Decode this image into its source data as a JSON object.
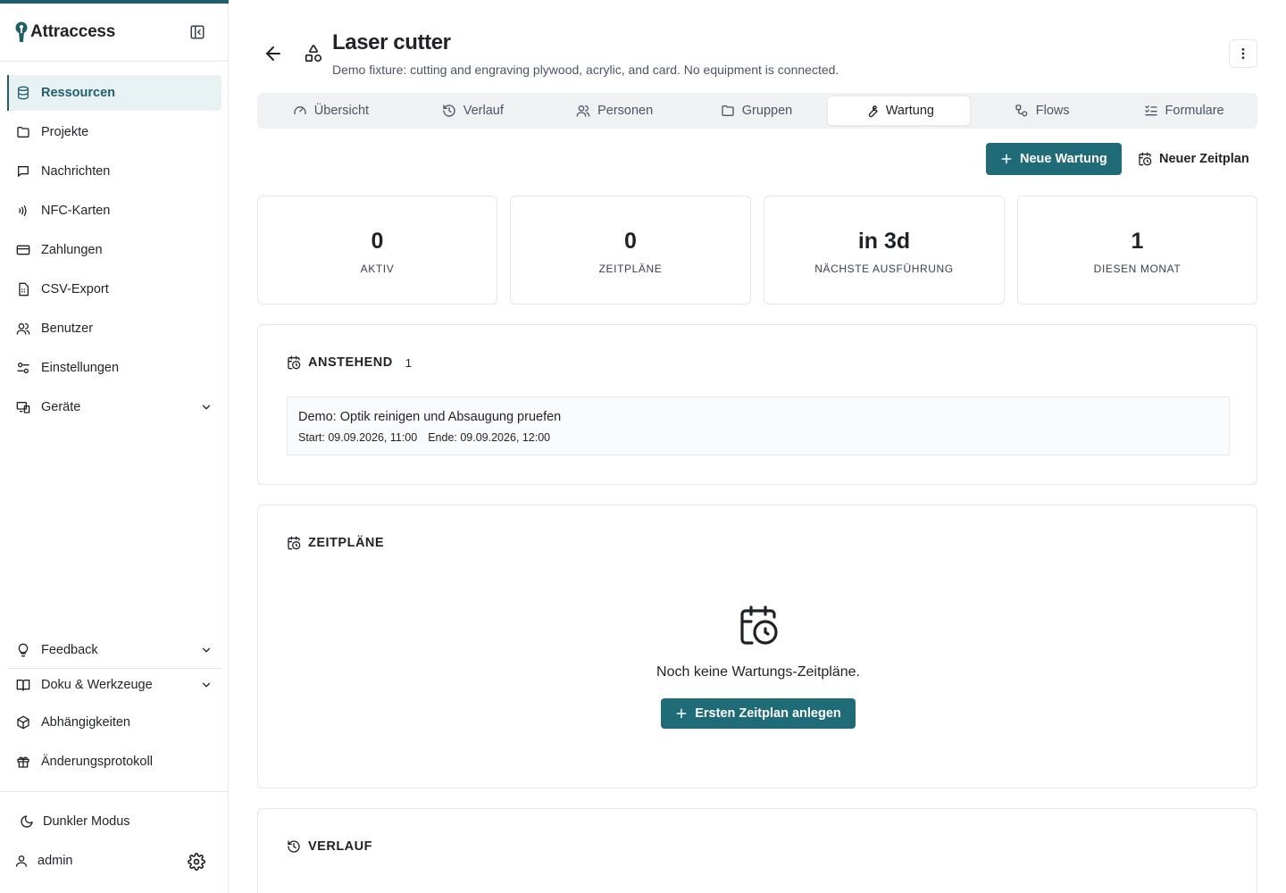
{
  "app": {
    "name": "Attraccess",
    "accent": "#1f6c78",
    "accent_light": "#e8f2f3"
  },
  "sidebar": {
    "items": [
      {
        "label": "Ressourcen",
        "icon": "database-icon",
        "active": true
      },
      {
        "label": "Projekte",
        "icon": "folder-icon"
      },
      {
        "label": "Nachrichten",
        "icon": "message-icon"
      },
      {
        "label": "NFC-Karten",
        "icon": "nfc-icon"
      },
      {
        "label": "Zahlungen",
        "icon": "credit-card-icon"
      },
      {
        "label": "CSV-Export",
        "icon": "csv-file-icon"
      },
      {
        "label": "Benutzer",
        "icon": "users-icon"
      },
      {
        "label": "Einstellungen",
        "icon": "sliders-icon"
      },
      {
        "label": "Geräte",
        "icon": "devices-icon",
        "expandable": true
      }
    ],
    "bottom_items": [
      {
        "label": "Feedback",
        "icon": "lightbulb-icon",
        "expandable": true
      },
      {
        "label": "Doku & Werkzeuge",
        "icon": "book-icon",
        "expandable": true
      },
      {
        "label": "Abhängigkeiten",
        "icon": "package-icon"
      },
      {
        "label": "Änderungsprotokoll",
        "icon": "gift-icon"
      }
    ],
    "dark_mode_label": "Dunkler Modus",
    "user_name": "admin"
  },
  "header": {
    "title": "Laser cutter",
    "subtitle": "Demo fixture: cutting and engraving plywood, acrylic, and card. No equipment is connected."
  },
  "tabs": [
    {
      "label": "Übersicht",
      "icon": "gauge-icon"
    },
    {
      "label": "Verlauf",
      "icon": "history-icon"
    },
    {
      "label": "Personen",
      "icon": "users-icon"
    },
    {
      "label": "Gruppen",
      "icon": "folder-icon"
    },
    {
      "label": "Wartung",
      "icon": "wrench-icon",
      "active": true
    },
    {
      "label": "Flows",
      "icon": "workflow-icon"
    },
    {
      "label": "Formulare",
      "icon": "list-check-icon"
    }
  ],
  "actions": {
    "new_maintenance": "Neue Wartung",
    "new_schedule": "Neuer Zeitplan"
  },
  "stats": [
    {
      "value": "0",
      "label": "AKTIV"
    },
    {
      "value": "0",
      "label": "ZEITPLÄNE"
    },
    {
      "value": "in 3d",
      "label": "NÄCHSTE AUSFÜHRUNG"
    },
    {
      "value": "1",
      "label": "DIESEN MONAT"
    }
  ],
  "upcoming": {
    "title": "ANSTEHEND",
    "count": "1",
    "items": [
      {
        "title": "Demo: Optik reinigen und Absaugung pruefen",
        "start": "Start: 09.09.2026, 11:00",
        "end": "Ende: 09.09.2026, 12:00"
      }
    ]
  },
  "schedules": {
    "title": "ZEITPLÄNE",
    "empty_text": "Noch keine Wartungs-Zeitpläne.",
    "empty_button": "Ersten Zeitplan anlegen"
  },
  "history": {
    "title": "VERLAUF"
  }
}
